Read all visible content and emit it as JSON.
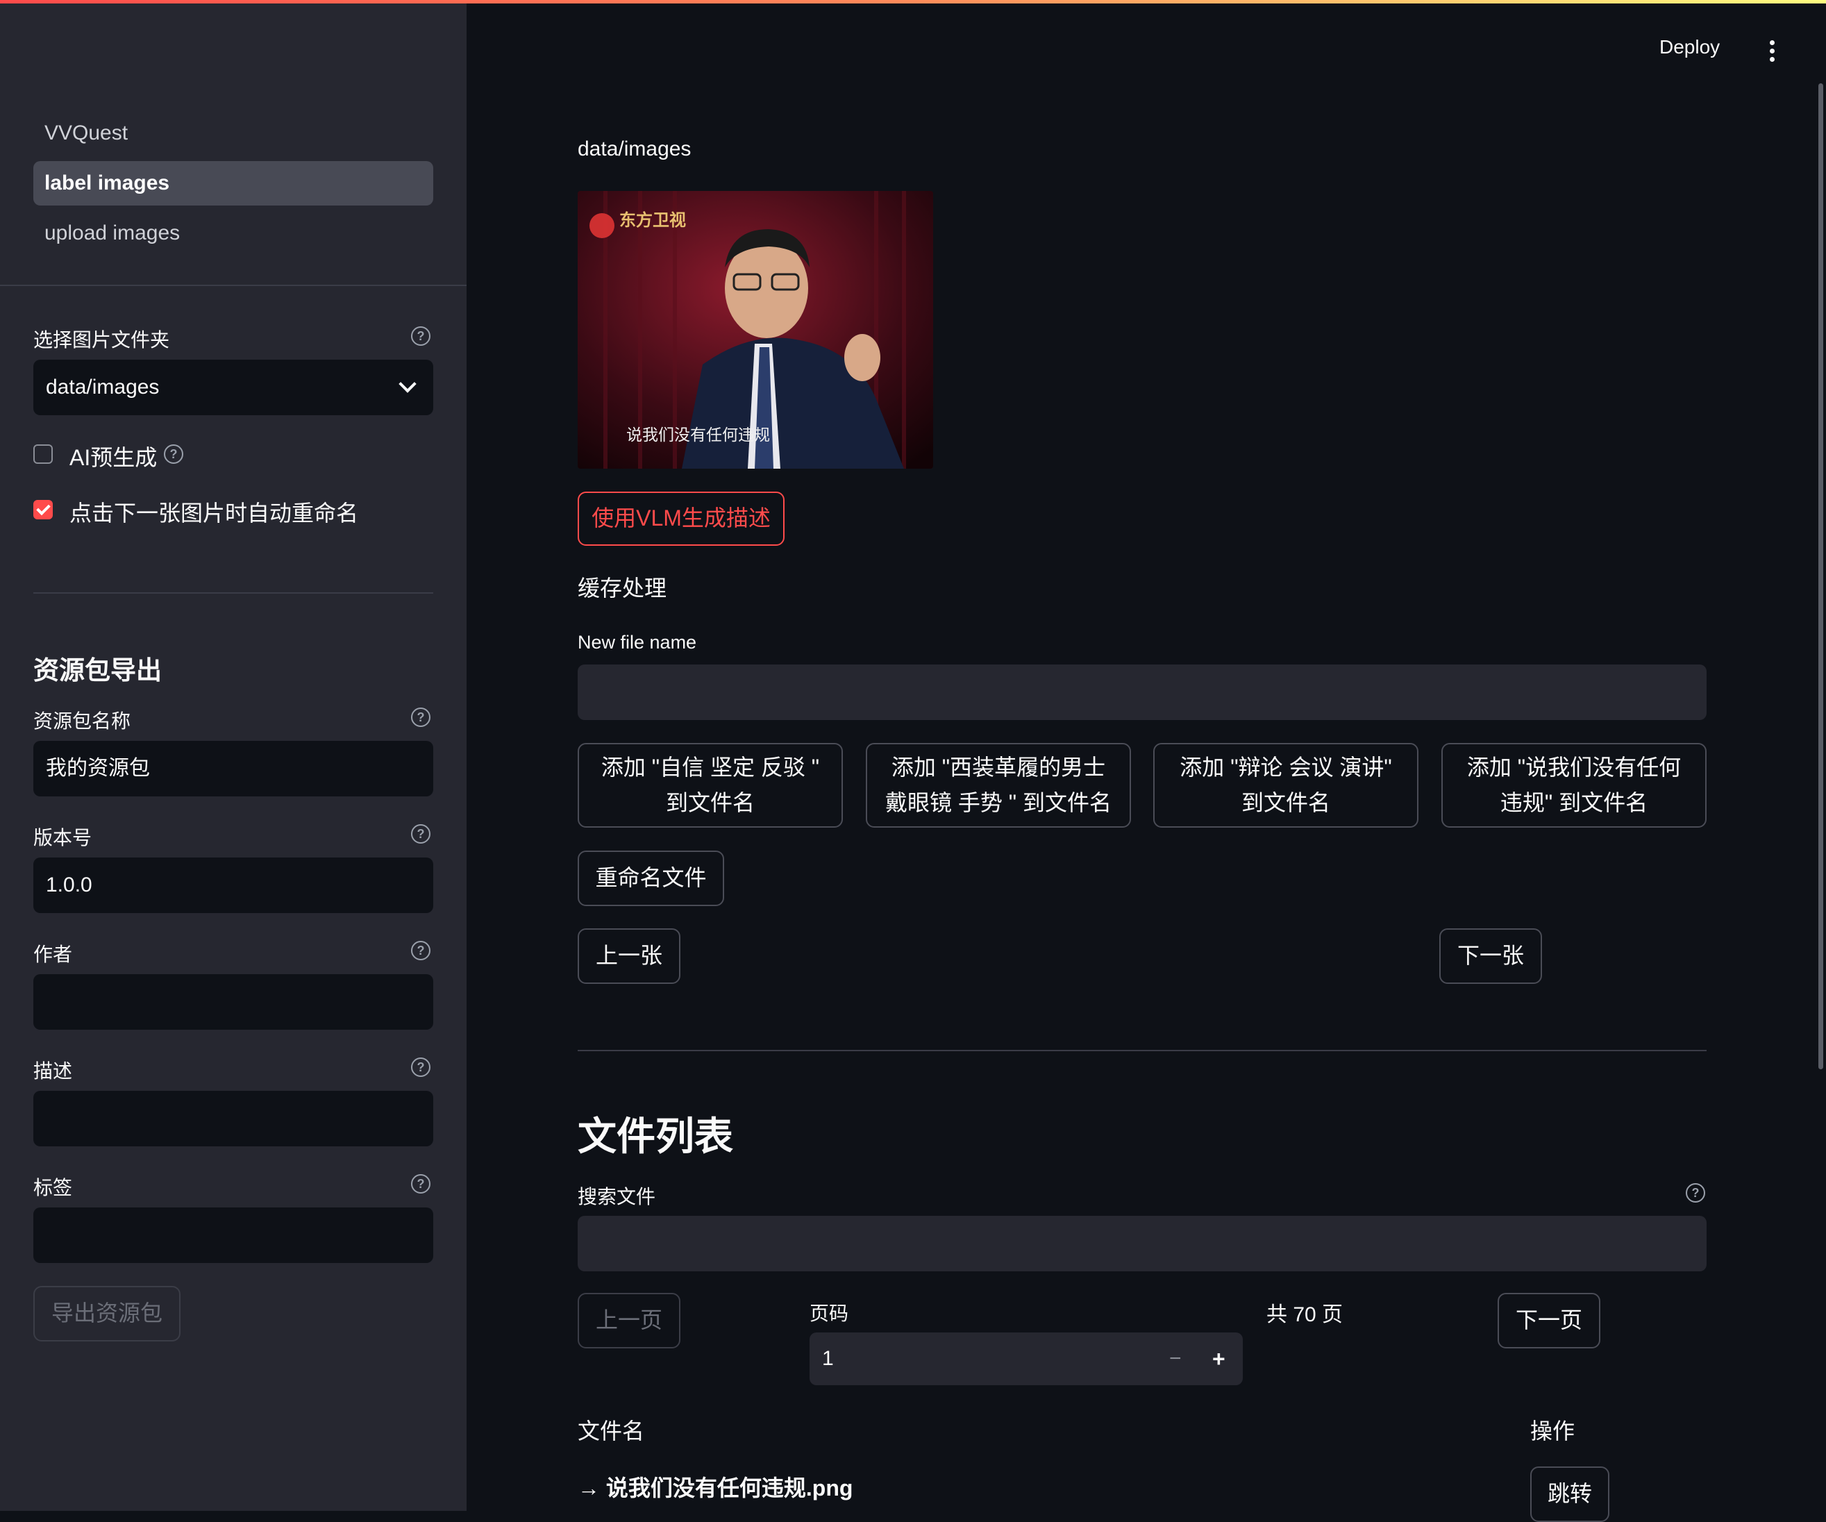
{
  "app": {
    "deploy_label": "Deploy"
  },
  "sidebar": {
    "nav": [
      {
        "label": "VVQuest",
        "active": false
      },
      {
        "label": "label images",
        "active": true
      },
      {
        "label": "upload images",
        "active": false
      }
    ],
    "folder_label": "选择图片文件夹",
    "folder_value": "data/images",
    "ai_pregen_label": "AI预生成",
    "ai_pregen_checked": false,
    "auto_rename_label": "点击下一张图片时自动重命名",
    "auto_rename_checked": true,
    "export_heading": "资源包导出",
    "pack_name_label": "资源包名称",
    "pack_name_value": "我的资源包",
    "version_label": "版本号",
    "version_value": "1.0.0",
    "author_label": "作者",
    "author_value": "",
    "desc_label": "描述",
    "desc_value": "",
    "tags_label": "标签",
    "tags_value": "",
    "export_button": "导出资源包"
  },
  "main": {
    "path": "data/images",
    "image_caption": "说我们没有任何违规",
    "image_logo_text": "东方卫视",
    "vlm_button": "使用VLM生成描述",
    "cache_heading": "缓存处理",
    "new_file_label": "New file name",
    "new_file_value": "",
    "suggestions": [
      {
        "line1": "添加 \"自信 坚定 反驳 \"",
        "line2": "到文件名"
      },
      {
        "line1": "添加 \"西装革履的男士",
        "line2": "戴眼镜 手势 \" 到文件名"
      },
      {
        "line1": "添加 \"辩论 会议 演讲\"",
        "line2": "到文件名"
      },
      {
        "line1": "添加 \"说我们没有任何",
        "line2": "违规\" 到文件名"
      }
    ],
    "rename_button": "重命名文件",
    "prev_button": "上一张",
    "next_button": "下一张",
    "file_list_heading": "文件列表",
    "search_label": "搜索文件",
    "search_value": "",
    "prev_page_button": "上一页",
    "page_label": "页码",
    "page_value": "1",
    "page_minus": "−",
    "page_plus": "+",
    "total_pages": "共 70 页",
    "next_page_button": "下一页",
    "col_filename": "文件名",
    "col_action": "操作",
    "rows": [
      {
        "name": "→ 说我们没有任何违规.png",
        "action": "跳转"
      }
    ]
  },
  "colors": {
    "accent": "#ff4b4b",
    "background": "#0e1117",
    "sidebar": "#262730"
  }
}
